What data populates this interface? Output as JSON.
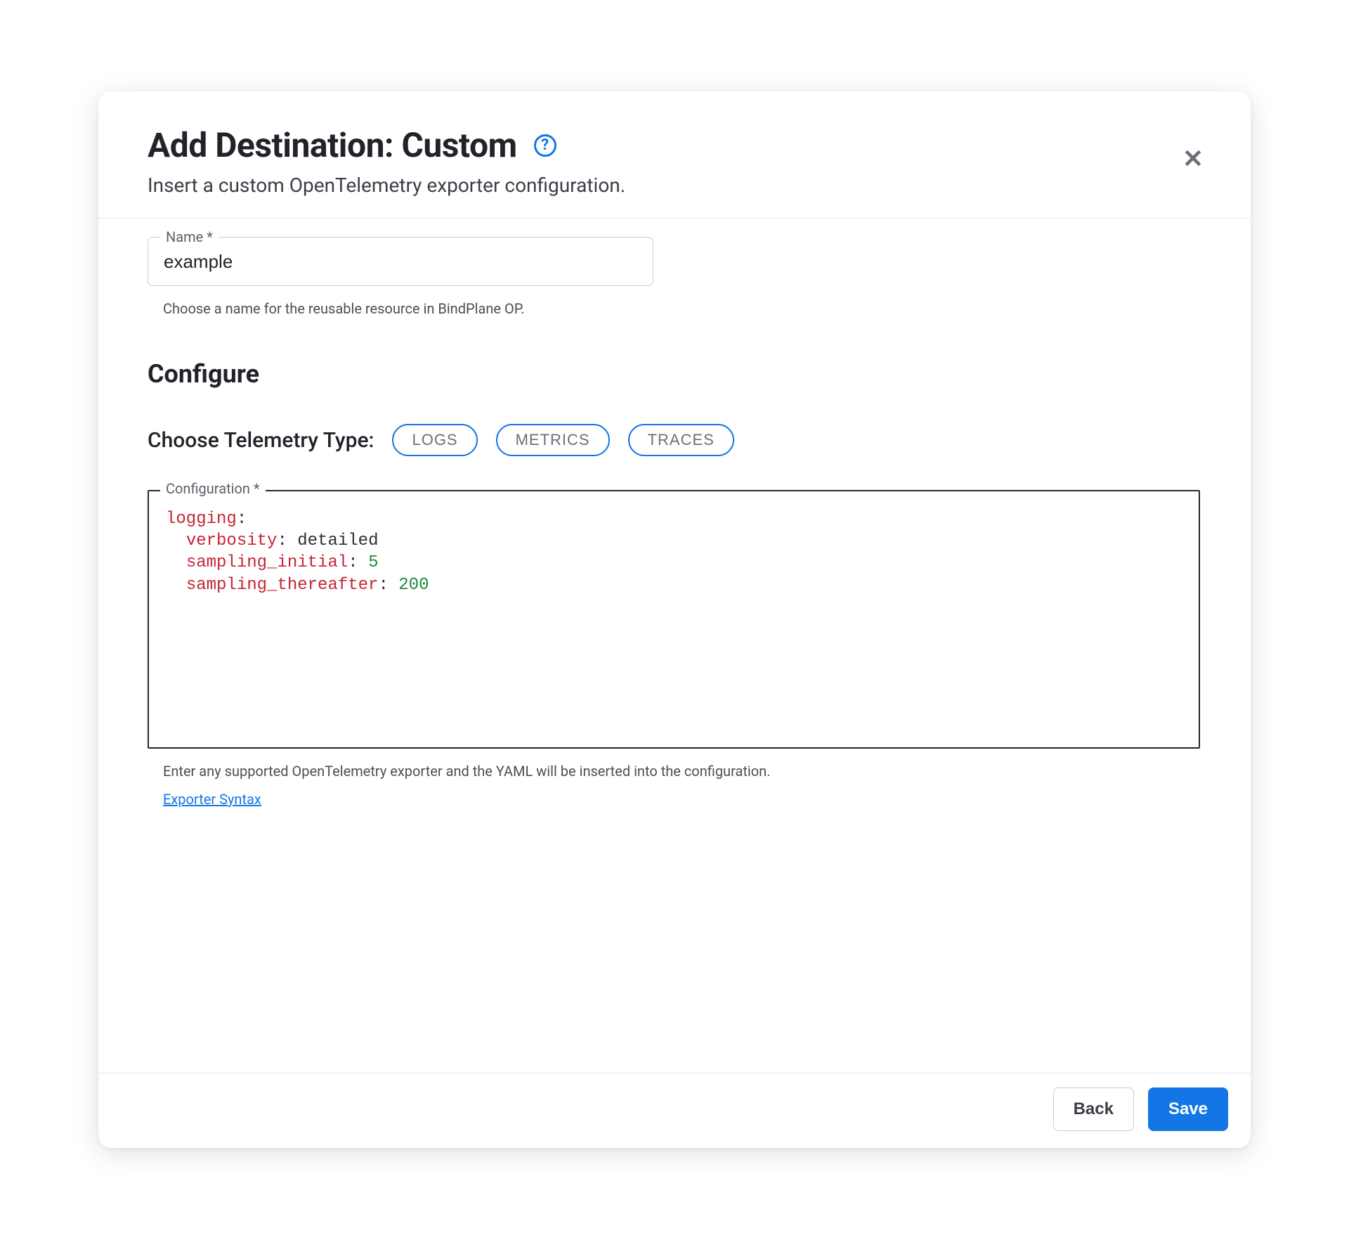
{
  "header": {
    "title": "Add Destination: Custom",
    "subtitle": "Insert a custom OpenTelemetry exporter configuration."
  },
  "form": {
    "name": {
      "label": "Name *",
      "value": "example",
      "help": "Choose a name for the reusable resource in BindPlane OP."
    },
    "configure_heading": "Configure",
    "telemetry": {
      "label": "Choose Telemetry Type:",
      "options": [
        "LOGS",
        "METRICS",
        "TRACES"
      ]
    },
    "configuration": {
      "label": "Configuration *",
      "yaml": {
        "root_key": "logging",
        "entries": [
          {
            "key": "verbosity",
            "value": "detailed",
            "value_type": "string"
          },
          {
            "key": "sampling_initial",
            "value": "5",
            "value_type": "number"
          },
          {
            "key": "sampling_thereafter",
            "value": "200",
            "value_type": "number"
          }
        ]
      },
      "help": "Enter any supported OpenTelemetry exporter and the YAML will be inserted into the configuration.",
      "link_label": "Exporter Syntax"
    }
  },
  "footer": {
    "back_label": "Back",
    "save_label": "Save"
  }
}
